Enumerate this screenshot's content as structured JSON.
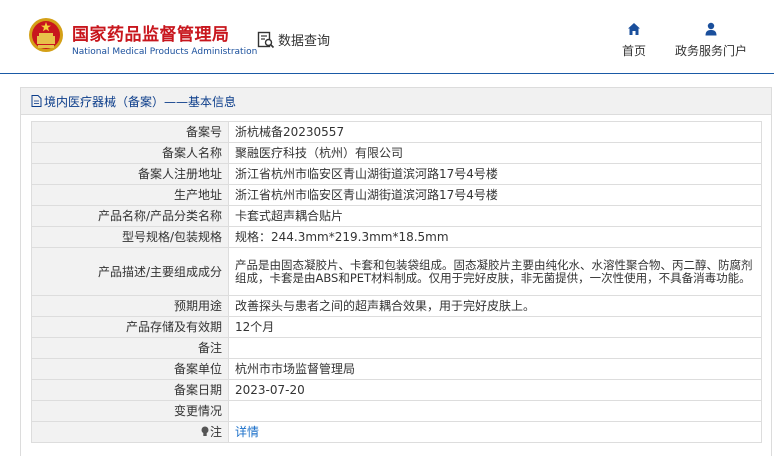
{
  "header": {
    "logo_cn": "国家药品监督管理局",
    "logo_en": "National Medical Products Administration",
    "query_label": "数据查询",
    "nav": [
      {
        "label": "首页",
        "icon": "home-icon"
      },
      {
        "label": "政务服务门户",
        "icon": "user-icon"
      }
    ]
  },
  "panel": {
    "title": "境内医疗器械（备案）——基本信息"
  },
  "rows": [
    {
      "label": "备案号",
      "value": "浙杭械备20230557"
    },
    {
      "label": "备案人名称",
      "value": "聚融医疗科技（杭州）有限公司"
    },
    {
      "label": "备案人注册地址",
      "value": "浙江省杭州市临安区青山湖街道滨河路17号4号楼"
    },
    {
      "label": "生产地址",
      "value": "浙江省杭州市临安区青山湖街道滨河路17号4号楼"
    },
    {
      "label": "产品名称/产品分类名称",
      "value": "卡套式超声耦合贴片"
    },
    {
      "label": "型号规格/包装规格",
      "value": "规格：244.3mm*219.3mm*18.5mm"
    },
    {
      "label": "产品描述/主要组成成分",
      "value": "产品是由固态凝胶片、卡套和包装袋组成。固态凝胶片主要由纯化水、水溶性聚合物、丙二醇、防腐剂组成，卡套是由ABS和PET材料制成。仅用于完好皮肤，非无菌提供，一次性使用，不具备消毒功能。"
    },
    {
      "label": "预期用途",
      "value": "改善探头与患者之间的超声耦合效果，用于完好皮肤上。"
    },
    {
      "label": "产品存储及有效期",
      "value": "12个月"
    },
    {
      "label": "备注",
      "value": ""
    },
    {
      "label": "备案单位",
      "value": "杭州市市场监督管理局"
    },
    {
      "label": "备案日期",
      "value": "2023-07-20"
    },
    {
      "label": "变更情况",
      "value": ""
    },
    {
      "label": "注",
      "value": "详情"
    }
  ],
  "colors": {
    "logo_red": "#c8161d",
    "brand_blue": "#1a4f9c",
    "link_blue": "#1a6fc9"
  }
}
